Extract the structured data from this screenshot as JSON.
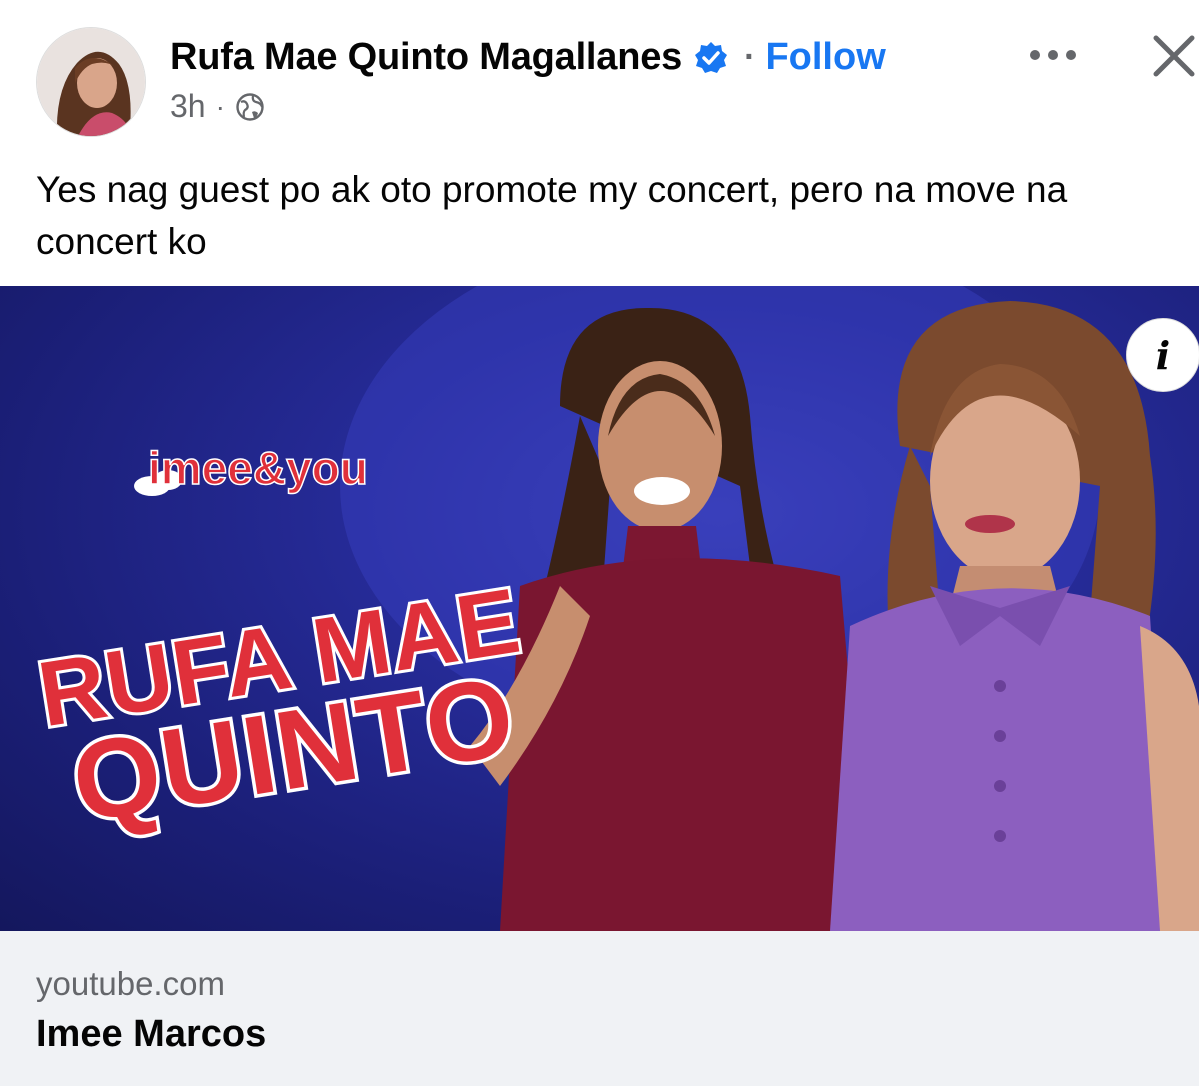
{
  "header": {
    "author_name": "Rufa Mae Quinto Magallanes",
    "separator": "·",
    "follow_label": "Follow",
    "timestamp": "3h",
    "meta_separator": "·",
    "icons": {
      "avatar": "profile-photo",
      "verified": "verified-badge-icon",
      "audience": "globe-icon",
      "more": "more-options-icon",
      "close": "close-icon"
    }
  },
  "post": {
    "caption": "Yes nag guest po ak oto promote my concert, pero na move na concert ko"
  },
  "media": {
    "show_logo": "imee&you",
    "headline_line1": "RUFA MAE",
    "headline_line2": "QUINTO",
    "info_label": "i"
  },
  "link_preview": {
    "domain": "youtube.com",
    "title": "Imee Marcos"
  },
  "colors": {
    "accent": "#1877f2",
    "secondary_text": "#65676b",
    "footer_bg": "#f0f2f5",
    "thumbnail_bg": "#262b98",
    "headline_red": "#e0303a"
  }
}
